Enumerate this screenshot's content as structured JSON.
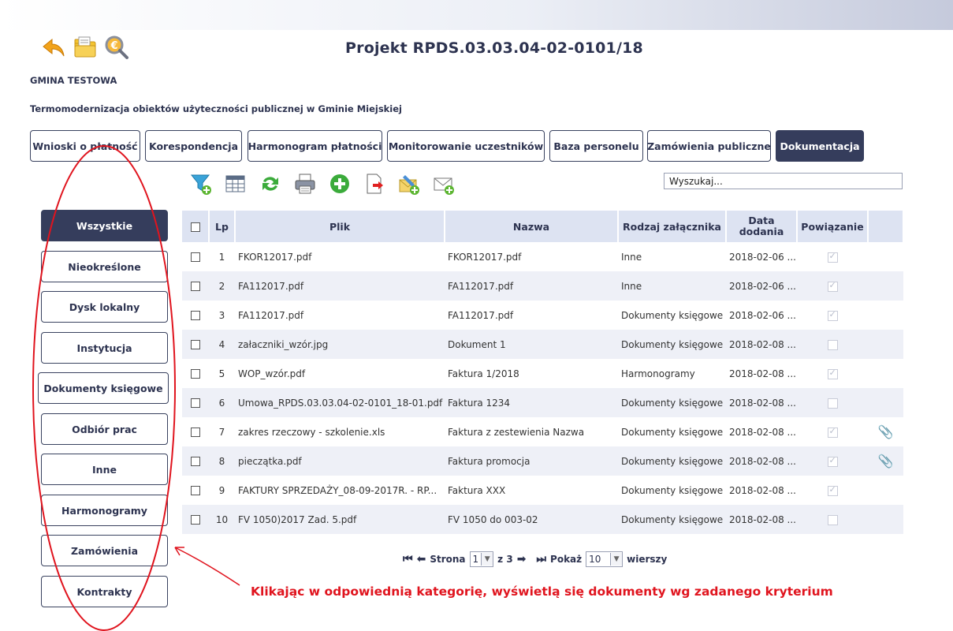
{
  "header": {
    "project_title": "Projekt RPDS.03.03.04-02-0101/18",
    "org_name": "GMINA TESTOWA",
    "project_subtitle": "Termomodernizacja obiektów użyteczności publicznej w Gminie Miejskiej",
    "icons": [
      "back-arrow-icon",
      "folder-icon",
      "euro-search-icon"
    ]
  },
  "tabs": [
    {
      "label": "Wnioski o płatność",
      "active": false
    },
    {
      "label": "Korespondencja",
      "active": false
    },
    {
      "label": "Harmonogram płatności",
      "active": false
    },
    {
      "label": "Monitorowanie uczestników",
      "active": false
    },
    {
      "label": "Baza personelu",
      "active": false
    },
    {
      "label": "Zamówienia publiczne",
      "active": false
    },
    {
      "label": "Dokumentacja",
      "active": true
    }
  ],
  "toolbar": {
    "icons": [
      "filter-add-icon",
      "table-columns-icon",
      "refresh-icon",
      "print-icon",
      "add-icon",
      "export-icon",
      "edit-attachment-icon",
      "mail-add-icon"
    ],
    "search_placeholder": "Wyszukaj..."
  },
  "sidebar": {
    "items": [
      {
        "label": "Wszystkie",
        "active": true
      },
      {
        "label": "Nieokreślone",
        "active": false
      },
      {
        "label": "Dysk lokalny",
        "active": false
      },
      {
        "label": "Instytucja",
        "active": false
      },
      {
        "label": "Dokumenty księgowe",
        "active": false
      },
      {
        "label": "Odbiór prac",
        "active": false
      },
      {
        "label": "Inne",
        "active": false
      },
      {
        "label": "Harmonogramy",
        "active": false
      },
      {
        "label": "Zamówienia",
        "active": false
      },
      {
        "label": "Kontrakty",
        "active": false
      }
    ]
  },
  "table": {
    "columns": {
      "lp": "Lp",
      "plik": "Plik",
      "nazwa": "Nazwa",
      "rodzaj": "Rodzaj załącznika",
      "data_line1": "Data",
      "data_line2": "dodania",
      "powiazanie": "Powiązanie"
    },
    "rows": [
      {
        "lp": "1",
        "plik": "FKOR12017.pdf",
        "nazwa": "FKOR12017.pdf",
        "rodzaj": "Inne",
        "data": "2018-02-06 ...",
        "powiazanie": true,
        "attachment": false
      },
      {
        "lp": "2",
        "plik": "FA112017.pdf",
        "nazwa": "FA112017.pdf",
        "rodzaj": "Inne",
        "data": "2018-02-06 ...",
        "powiazanie": true,
        "attachment": false
      },
      {
        "lp": "3",
        "plik": "FA112017.pdf",
        "nazwa": "FA112017.pdf",
        "rodzaj": "Dokumenty księgowe",
        "data": "2018-02-06 ...",
        "powiazanie": true,
        "attachment": false
      },
      {
        "lp": "4",
        "plik": "załaczniki_wzór.jpg",
        "nazwa": "Dokument 1",
        "rodzaj": "Dokumenty księgowe",
        "data": "2018-02-08 ...",
        "powiazanie": false,
        "attachment": false
      },
      {
        "lp": "5",
        "plik": "WOP_wzór.pdf",
        "nazwa": "Faktura 1/2018",
        "rodzaj": "Harmonogramy",
        "data": "2018-02-08 ...",
        "powiazanie": true,
        "attachment": false
      },
      {
        "lp": "6",
        "plik": "Umowa_RPDS.03.03.04-02-0101_18-01.pdf",
        "nazwa": "Faktura 1234",
        "rodzaj": "Dokumenty księgowe",
        "data": "2018-02-08 ...",
        "powiazanie": false,
        "attachment": false
      },
      {
        "lp": "7",
        "plik": "zakres rzeczowy - szkolenie.xls",
        "nazwa": "Faktura z zestewienia Nazwa",
        "rodzaj": "Dokumenty księgowe",
        "data": "2018-02-08 ...",
        "powiazanie": true,
        "attachment": true
      },
      {
        "lp": "8",
        "plik": "pieczątka.pdf",
        "nazwa": "Faktura promocja",
        "rodzaj": "Dokumenty księgowe",
        "data": "2018-02-08 ...",
        "powiazanie": true,
        "attachment": true
      },
      {
        "lp": "9",
        "plik": "FAKTURY SPRZEDAŻY_08-09-2017R. - RP...",
        "nazwa": "Faktura XXX",
        "rodzaj": "Dokumenty księgowe",
        "data": "2018-02-08 ...",
        "powiazanie": true,
        "attachment": false
      },
      {
        "lp": "10",
        "plik": "FV 1050)2017 Zad. 5.pdf",
        "nazwa": "FV 1050 do 003-02",
        "rodzaj": "Dokumenty księgowe",
        "data": "2018-02-08 ...",
        "powiazanie": false,
        "attachment": false
      }
    ]
  },
  "pager": {
    "strona_label": "Strona",
    "current_page": "1",
    "of_label": "z 3",
    "pokaz_label": "Pokaż",
    "page_size": "10",
    "wierszy_label": "wierszy"
  },
  "annotation": {
    "text": "Klikając w odpowiednią kategorię, wyświetlą się dokumenty wg zadanego kryterium",
    "color": "#e0141e"
  },
  "colors": {
    "active_bg": "#353d5c",
    "header_bg": "#dde3f2",
    "alt_row_bg": "#eef0f7"
  }
}
